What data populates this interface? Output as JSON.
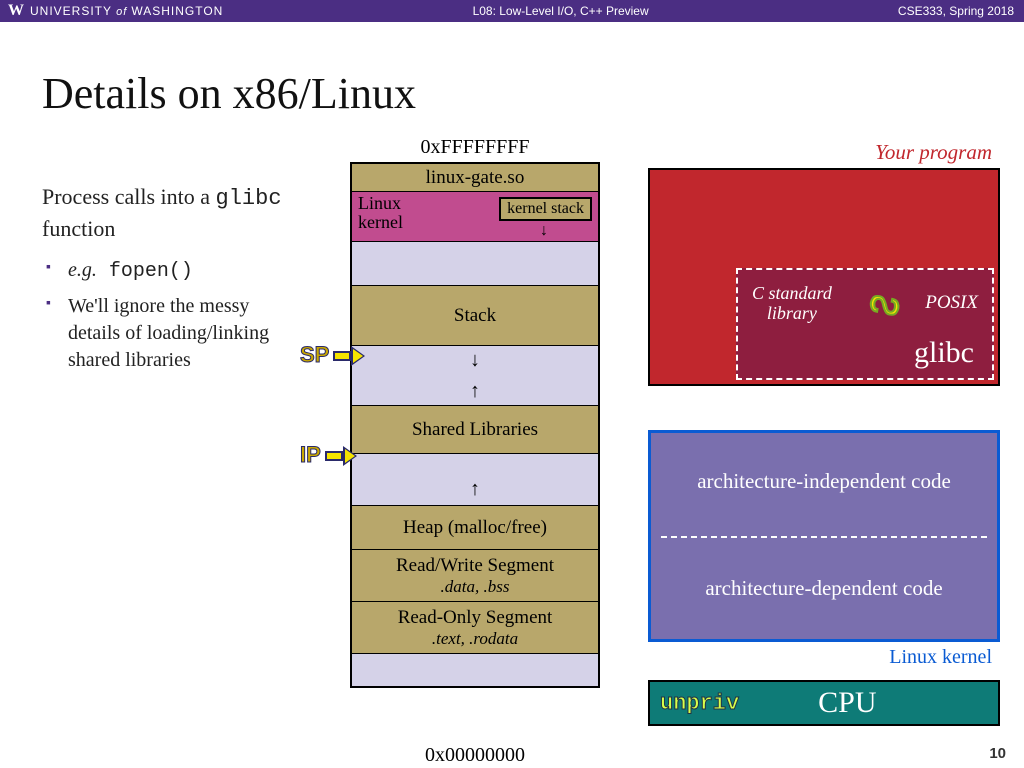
{
  "header": {
    "logo": "W",
    "uni_pre": "UNIVERSITY",
    "uni_of": " of ",
    "uni_post": "WASHINGTON",
    "center": "L08: Low-Level I/O, C++ Preview",
    "right": "CSE333, Spring 2018"
  },
  "title": "Details on x86/Linux",
  "body": {
    "line1a": "Process calls into a ",
    "line1b": "glibc",
    "line1c": " function",
    "b1_pre": "e.g.",
    "b1_code": " fopen()",
    "b2": "We'll ignore the messy details of loading/linking shared libraries"
  },
  "mem": {
    "top": "0xFFFFFFFF",
    "bottom": "0x00000000",
    "linuxgate": "linux-gate.so",
    "kernel": "Linux\nkernel",
    "kstack": "kernel stack",
    "stack": "Stack",
    "shlib": "Shared Libraries",
    "heap": "Heap (malloc/free)",
    "rw_t": "Read/Write Segment",
    "rw_s": ".data, .bss",
    "ro_t": "Read-Only Segment",
    "ro_s": ".text, .rodata"
  },
  "ptr": {
    "sp": "SP",
    "ip": "IP"
  },
  "right": {
    "yp": "Your program",
    "cstd": "C standard\nlibrary",
    "posix": "POSIX",
    "glibc": "glibc",
    "arch_indep": "architecture-independent code",
    "arch_dep": "architecture-dependent code",
    "lk": "Linux kernel",
    "unpriv": "unpriv",
    "cpu": "CPU"
  },
  "pagenum": "10"
}
